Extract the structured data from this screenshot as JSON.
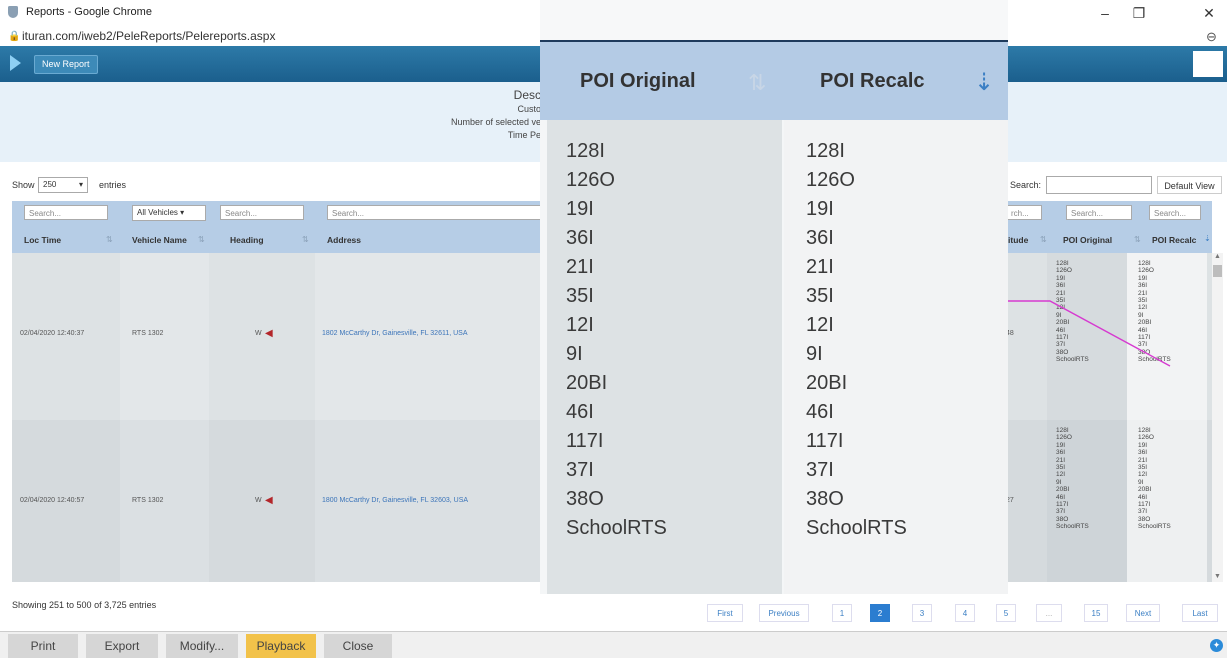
{
  "window": {
    "title": "Reports - Google Chrome",
    "minimize": "–",
    "restore": "❐",
    "close": "✕"
  },
  "addressbar": {
    "url": "ituran.com/iweb2/PeleReports/Pelereports.aspx",
    "lock": "🔒",
    "zoom": "⊖"
  },
  "toolbar": {
    "new_report_label": "New Report"
  },
  "header": {
    "line1": "Desc",
    "line2": "Custo",
    "line3": "Number of selected ve",
    "line4": "Time Pe"
  },
  "controls": {
    "show_label": "Show",
    "page_size": "250",
    "entries_label": "entries",
    "search_label": "Search:",
    "search_value": "",
    "default_view_label": "Default View"
  },
  "filters": {
    "search_placeholder": "Search...",
    "vehicles_select": "All Vehicles",
    "rch_label": "rch..."
  },
  "columns": {
    "loc_time": "Loc Time",
    "vehicle_name": "Vehicle Name",
    "heading": "Heading",
    "address": "Address",
    "latitude": "itude",
    "poi_original": "POI Original",
    "poi_recalc": "POI Recalc"
  },
  "rows": [
    {
      "loc_time": "02/04/2020 12:40:37",
      "vehicle": "RTS 1302",
      "heading": "W",
      "address": "1802 McCarthy Dr, Gainesville, FL 32611, USA",
      "lat": "48",
      "poi_original": [
        "128I",
        "126O",
        "19I",
        "36I",
        "21I",
        "35I",
        "12I",
        "9I",
        "20BI",
        "46I",
        "117I",
        "37I",
        "38O",
        "SchoolRTS"
      ],
      "poi_recalc": [
        "128I",
        "126O",
        "19I",
        "36I",
        "21I",
        "35I",
        "12I",
        "9I",
        "20BI",
        "46I",
        "117I",
        "37I",
        "38O",
        "SchoolRTS"
      ]
    },
    {
      "loc_time": "02/04/2020 12:40:57",
      "vehicle": "RTS 1302",
      "heading": "W",
      "address": "1800 McCarthy Dr, Gainesville, FL 32603, USA",
      "lat": "27",
      "poi_original": [
        "128I",
        "126O",
        "19I",
        "36I",
        "21I",
        "35I",
        "12I",
        "9I",
        "20BI",
        "46I",
        "117I",
        "37I",
        "38O",
        "SchoolRTS"
      ],
      "poi_recalc": [
        "128I",
        "126O",
        "19I",
        "36I",
        "21I",
        "35I",
        "12I",
        "9I",
        "20BI",
        "46I",
        "117I",
        "37I",
        "38O",
        "SchoolRTS"
      ]
    }
  ],
  "zoom_overlay": {
    "header_left": "POI Original",
    "header_right": "POI Recalc",
    "left_values": [
      "128I",
      "126O",
      "19I",
      "36I",
      "21I",
      "35I",
      "12I",
      "9I",
      "20BI",
      "46I",
      "117I",
      "37I",
      "38O",
      "SchoolRTS"
    ],
    "right_values": [
      "128I",
      "126O",
      "19I",
      "36I",
      "21I",
      "35I",
      "12I",
      "9I",
      "20BI",
      "46I",
      "117I",
      "37I",
      "38O",
      "SchoolRTS"
    ]
  },
  "footer": {
    "info": "Showing 251 to 500 of 3,725 entries",
    "pagination": {
      "first": "First",
      "previous": "Previous",
      "p1": "1",
      "p2": "2",
      "p3": "3",
      "p4": "4",
      "p5": "5",
      "ellipsis": "...",
      "p15": "15",
      "next": "Next",
      "last": "Last"
    }
  },
  "bottom_buttons": {
    "print": "Print",
    "export": "Export",
    "modify": "Modify...",
    "playback": "Playback",
    "close": "Close"
  },
  "colors": {
    "toolbar": "#1b5f8d",
    "table_header": "#b6cde6",
    "active_page": "#2b7dd0",
    "playback": "#f2c24a",
    "annotation": "#d63ad0"
  }
}
